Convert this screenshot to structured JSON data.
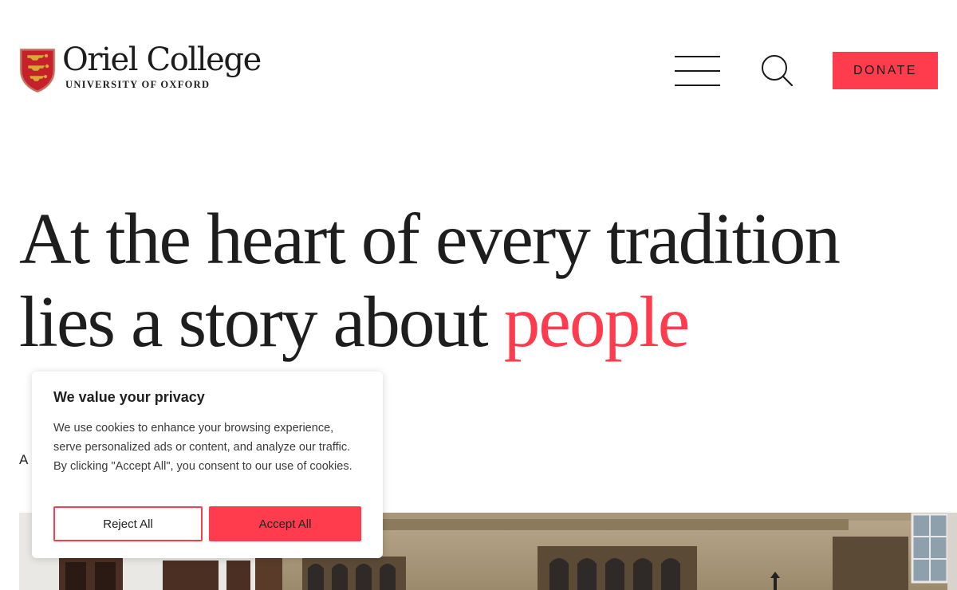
{
  "header": {
    "logo_name": "Oriel College",
    "logo_subtitle": "UNIVERSITY OF OXFORD",
    "menu_icon": "hamburger-menu-icon",
    "search_icon": "search-icon",
    "donate_label": "DONATE"
  },
  "hero": {
    "line1": "At the heart of every tradition",
    "line2_start": "lies a story about ",
    "line2_accent": "people",
    "partial_text": "A"
  },
  "cookie_banner": {
    "title": "We value your privacy",
    "text": "We use cookies to enhance your browsing experience, serve personalized ads or content, and analyze our traffic. By clicking \"Accept All\", you consent to our use of cookies.",
    "reject_label": "Reject All",
    "accept_label": "Accept All"
  },
  "colors": {
    "accent": "#ff3c4e",
    "text": "#1e1e1e",
    "background": "#ffffff"
  }
}
